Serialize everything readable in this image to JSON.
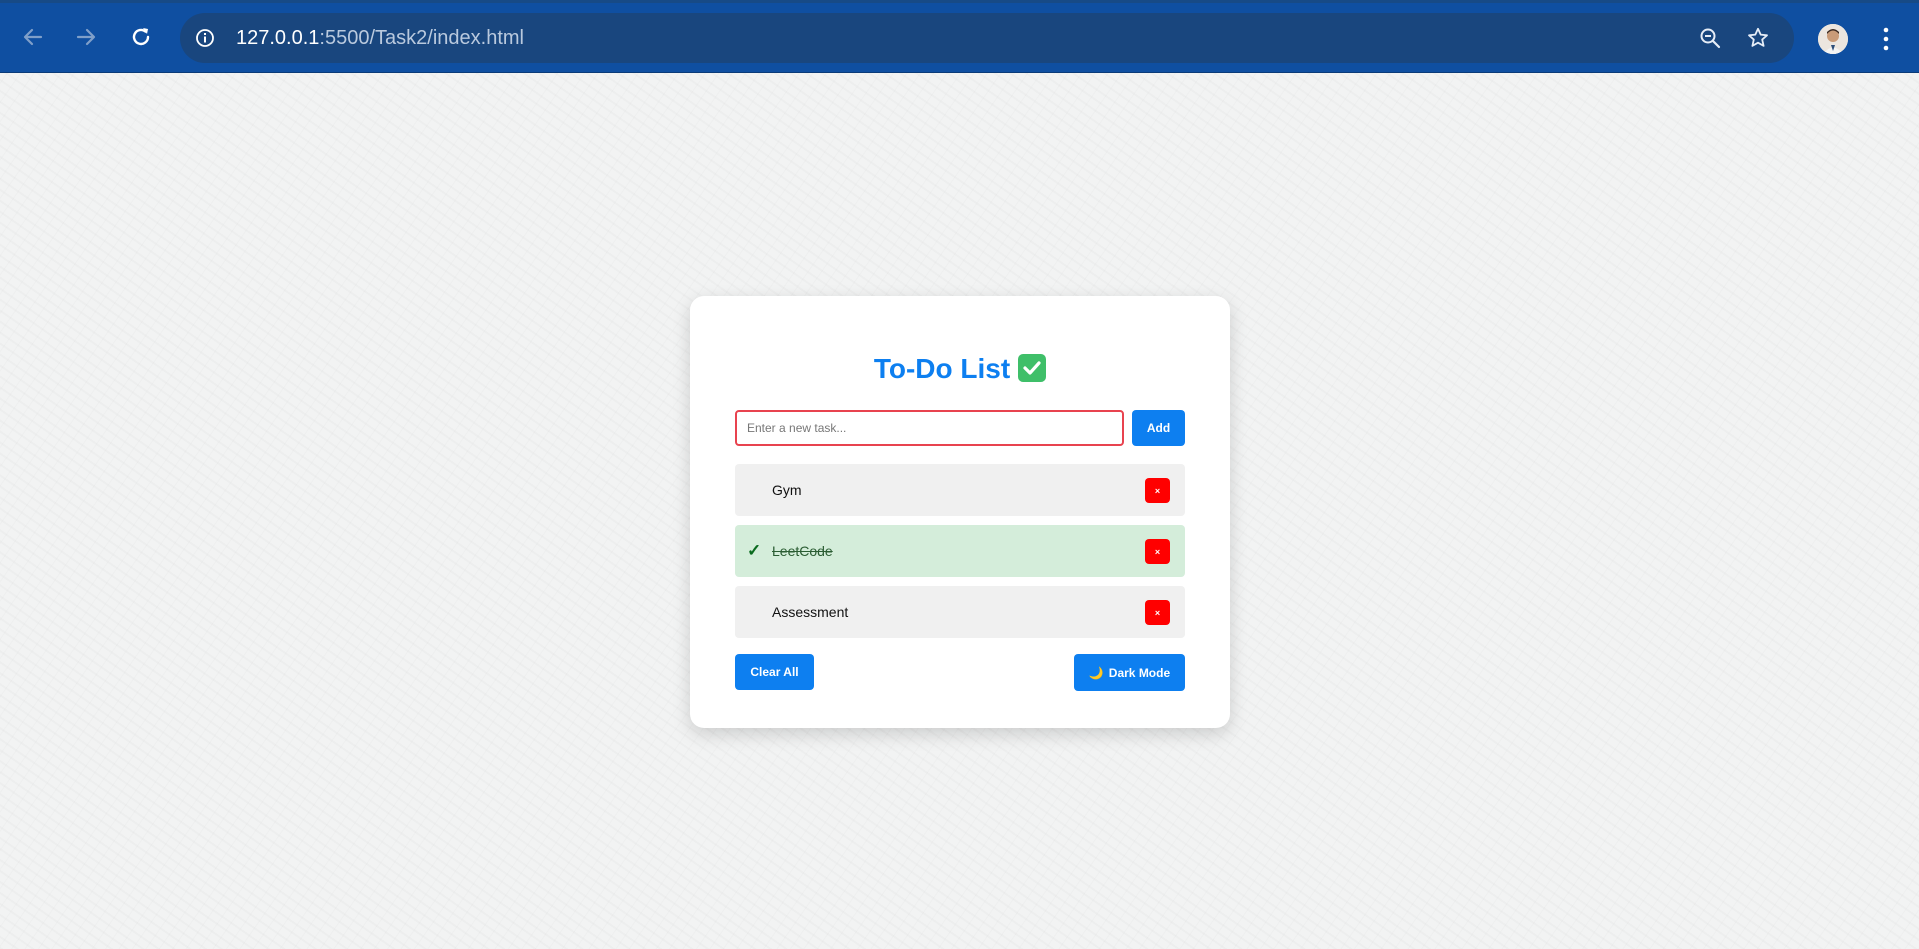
{
  "browser": {
    "url_host": "127.0.0.1",
    "url_path": ":5500/Task2/index.html",
    "icons": [
      "back-arrow-icon",
      "forward-arrow-icon",
      "reload-icon",
      "site-info-icon",
      "zoom-icon",
      "bookmark-star-icon",
      "profile-avatar",
      "more-menu-icon"
    ]
  },
  "todo": {
    "title": "To-Do List",
    "title_emoji": "white-heavy-check-mark",
    "input": {
      "placeholder": "Enter a new task...",
      "value": ""
    },
    "add_label": "Add",
    "tasks": [
      {
        "text": "Gym",
        "completed": false,
        "delete_label": "×"
      },
      {
        "text": "LeetCode",
        "completed": true,
        "check": "✓",
        "delete_label": "×"
      },
      {
        "text": "Assessment",
        "completed": false,
        "delete_label": "×"
      }
    ],
    "clear_all_label": "Clear All",
    "dark_mode_label": "Dark Mode",
    "dark_mode_icon": "🌙"
  },
  "colors": {
    "browser_bar": "#0f4fa1",
    "accent": "#0d7ff0",
    "completed_bg": "#d4edda",
    "delete": "#ff0000",
    "input_border": "#e8434f"
  }
}
